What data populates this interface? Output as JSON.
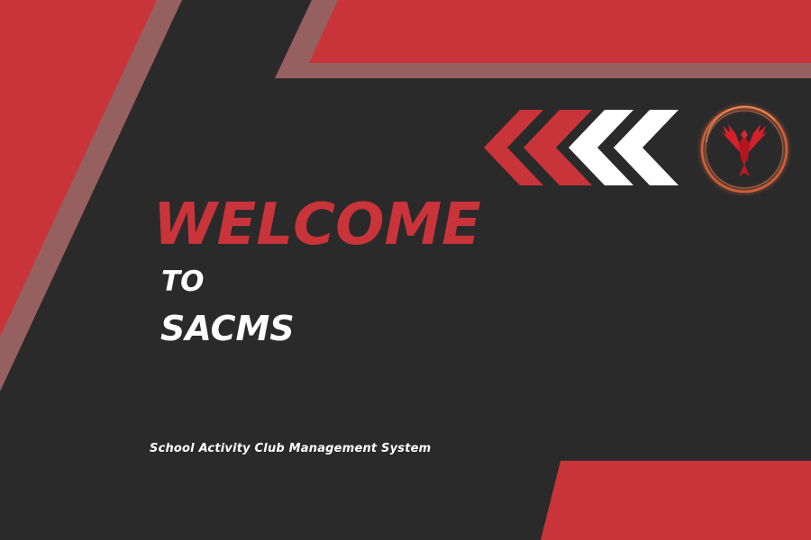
{
  "colors": {
    "background": "#2b2a2b",
    "accent": "#c8343a",
    "accent_muted": "#966060",
    "chevron_white": "#ffffff"
  },
  "hero": {
    "welcome": "WELCOME",
    "to": "TO",
    "brand": "SACMS",
    "subtitle": "School Activity Club Management System"
  },
  "icons": {
    "chevrons": "double-chevron-left-icon",
    "logo": "phoenix-logo"
  }
}
